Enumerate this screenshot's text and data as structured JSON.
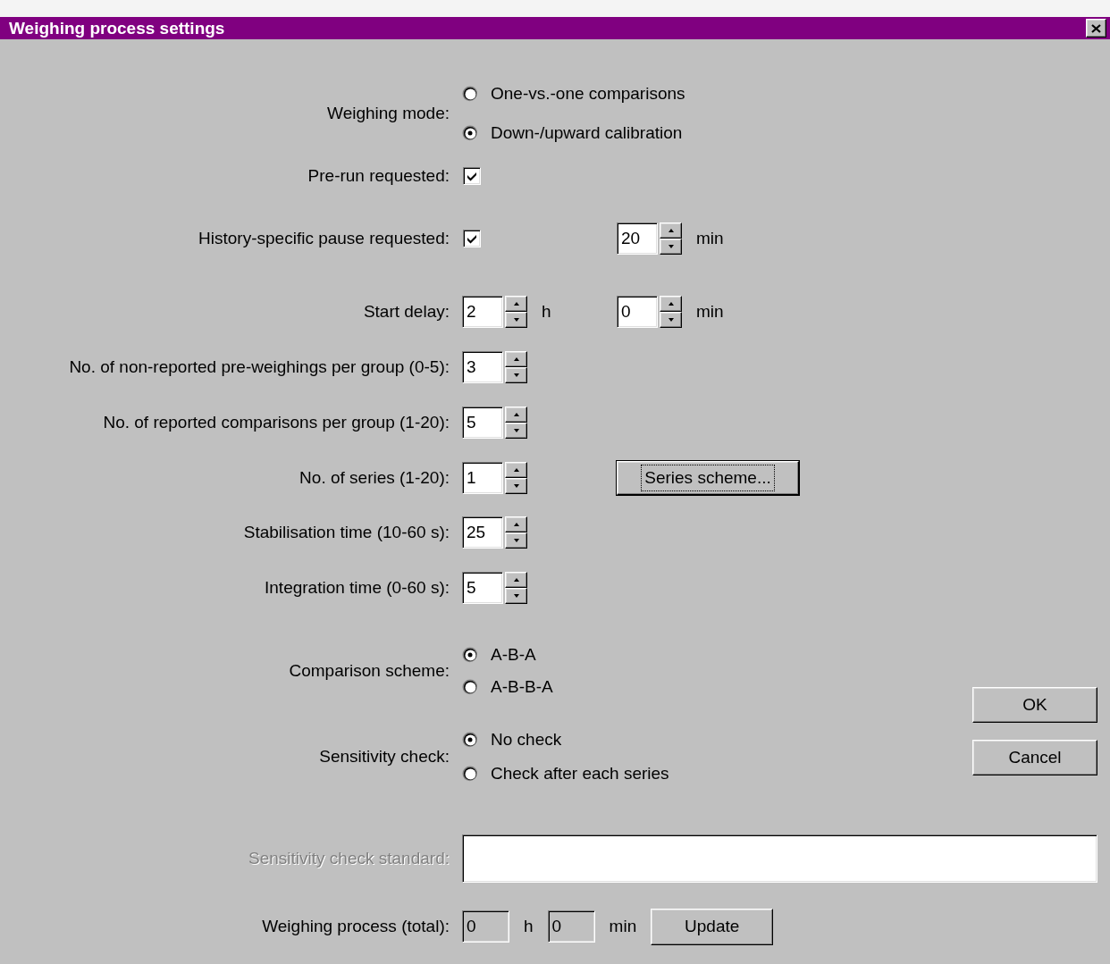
{
  "window": {
    "title": "Weighing process settings"
  },
  "rows": [
    {
      "kind": "radio",
      "label": "Weighing mode:",
      "options": [
        {
          "label": "One-vs.-one comparisons",
          "selected": false
        },
        {
          "label": "Down-/upward calibration",
          "selected": true
        }
      ]
    },
    {
      "kind": "check",
      "label": "Pre-run requested:",
      "checked": true
    },
    {
      "kind": "check",
      "label": "History-specific pause requested:",
      "checked": true,
      "spinners": [
        {
          "value": "20",
          "unit": "min"
        }
      ]
    },
    {
      "kind": "spin",
      "label": "Start delay:",
      "spinners": [
        {
          "value": "2",
          "unit": "h"
        },
        {
          "value": "0",
          "unit": "min"
        }
      ]
    },
    {
      "kind": "spin",
      "label": "No. of non-reported pre-weighings per group (0-5):",
      "spinners": [
        {
          "value": "3"
        }
      ]
    },
    {
      "kind": "spin",
      "label": "No. of reported comparisons per group (1-20):",
      "spinners": [
        {
          "value": "5"
        }
      ]
    },
    {
      "kind": "spin",
      "label": "No. of series (1-20):",
      "spinners": [
        {
          "value": "1"
        }
      ],
      "button": {
        "label": "Series scheme...",
        "focused": true
      }
    },
    {
      "kind": "spin",
      "label": "Stabilisation time (10-60 s):",
      "spinners": [
        {
          "value": "25"
        }
      ]
    },
    {
      "kind": "spin",
      "label": "Integration time (0-60 s):",
      "spinners": [
        {
          "value": "5"
        }
      ]
    }
  ],
  "schemes": [
    {
      "kind": "radio",
      "label": "Comparison scheme:",
      "options": [
        {
          "label": "A-B-A",
          "selected": true
        },
        {
          "label": "A-B-B-A",
          "selected": false
        }
      ]
    },
    {
      "kind": "radio",
      "label": "Sensitivity check:",
      "options": [
        {
          "label": "No check",
          "selected": true
        },
        {
          "label": "Check after each series",
          "selected": false
        }
      ]
    }
  ],
  "dialog_buttons": [
    {
      "label": "OK",
      "focused": false
    },
    {
      "label": "Cancel",
      "focused": false
    }
  ],
  "standard": {
    "label": "Sensitivity check standard:",
    "disabled": true
  },
  "total": {
    "label": "Weighing process (total):",
    "disabled": true,
    "fields": [
      {
        "value": "0",
        "unit": "h"
      },
      {
        "value": "0",
        "unit": "min"
      }
    ],
    "button": {
      "label": "Update",
      "focused": false
    }
  }
}
